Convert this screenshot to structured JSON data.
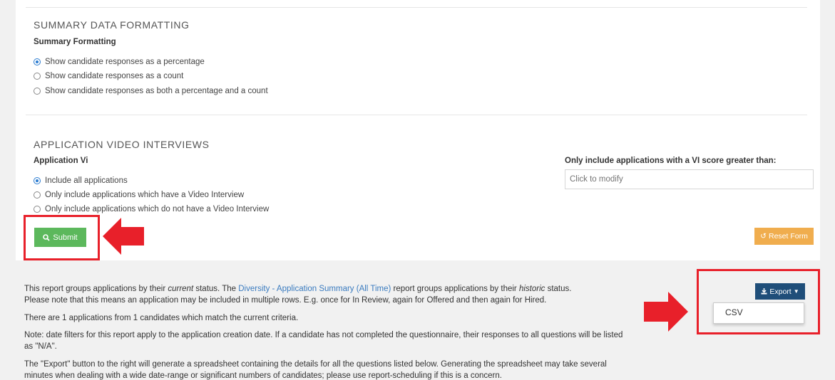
{
  "summary": {
    "section_title": "SUMMARY DATA FORMATTING",
    "label": "Summary Formatting",
    "options": [
      {
        "label": "Show candidate responses as a percentage",
        "checked": true
      },
      {
        "label": "Show candidate responses as a count",
        "checked": false
      },
      {
        "label": "Show candidate responses as both a percentage and a count",
        "checked": false
      }
    ]
  },
  "video": {
    "section_title": "APPLICATION VIDEO INTERVIEWS",
    "label": "Application Vi",
    "options": [
      {
        "label": "Include all applications",
        "checked": true
      },
      {
        "label": "Only include applications which have a Video Interview",
        "checked": false
      },
      {
        "label": "Only include applications which do not have a Video Interview",
        "checked": false
      }
    ],
    "score_label": "Only include applications with a VI score greater than:",
    "score_placeholder": "Click to modify"
  },
  "buttons": {
    "submit": "Submit",
    "reset": "Reset Form",
    "export": "Export",
    "export_menu": [
      "CSV"
    ]
  },
  "info": {
    "line1_a": "This report groups applications by their ",
    "line1_current": "current",
    "line1_b": " status. The ",
    "line1_link": "Diversity - Application Summary (All Time)",
    "line1_c": " report groups applications by their ",
    "line1_historic": "historic",
    "line1_d": " status.",
    "line2": "Please note that this means an application may be included in multiple rows. E.g. once for In Review, again for Offered and then again for Hired.",
    "line3": "There are 1 applications from 1 candidates which match the current criteria.",
    "line4a": "Note: date filters for this report apply to the application creation date. If a candidate has not completed the questionnaire, their responses to all questions will be listed",
    "line4b": "as \"N/A\".",
    "line5a": "The \"Export\" button to the right will generate a spreadsheet containing the details for all the questions listed below. Generating the spreadsheet may take several",
    "line5b": "minutes when dealing with a wide date-range or significant numbers of candidates; please use report-scheduling if this is a concern."
  },
  "colors": {
    "submit": "#5cb85c",
    "reset": "#f0ad4e",
    "export": "#1f4e79",
    "annotation": "#e8202a",
    "link": "#3a7bbf"
  }
}
